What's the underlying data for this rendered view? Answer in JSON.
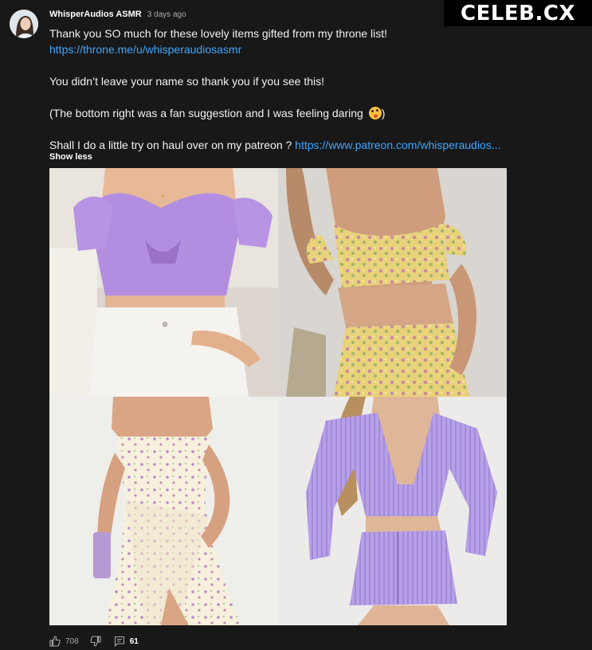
{
  "comment": {
    "author": "WhisperAudios ASMR",
    "time": "3 days ago",
    "line1": "Thank you SO much for these lovely items gifted from my throne list!",
    "link1": "https://throne.me/u/whisperaudiosasmr",
    "line2": "You didn’t leave your name so thank you if you see this!",
    "line3_text": "(The bottom right was a fan suggestion and I was feeling daring ",
    "line3_emoji": "winking-face-with-tongue-emoji",
    "line3_close": ")",
    "line4_text": "Shall I do a little try on haul over on my patreon ? ",
    "link2": "https://www.patreon.com/whisperaudios...",
    "show_less": "Show less"
  },
  "images": [
    {
      "name": "lilac twist crop top with white jeans"
    },
    {
      "name": "yellow floral crop top and skirt set"
    },
    {
      "name": "cream floral wrap mini dress with lilac bag"
    },
    {
      "name": "lilac plisse cut-out top and ruched skirt"
    }
  ],
  "actions": {
    "likes": "708",
    "replies": "61"
  },
  "watermark": "CELEB.CX",
  "colors": {
    "background": "#181818",
    "link": "#3ea6ff",
    "muted": "#aaaaaa"
  }
}
